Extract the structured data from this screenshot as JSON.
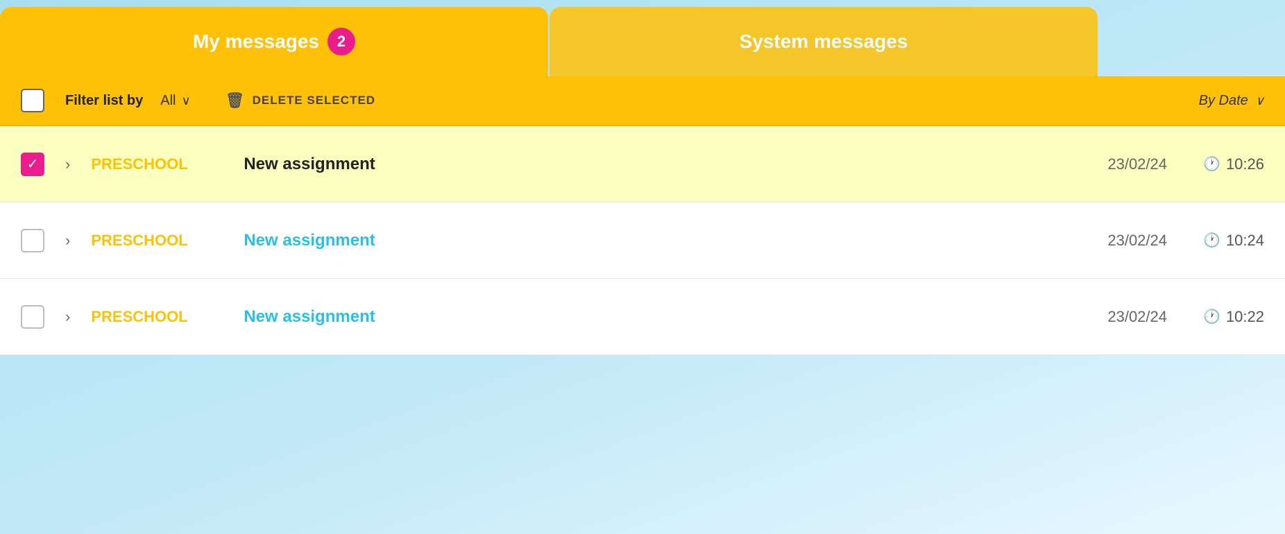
{
  "tabs": {
    "my_messages": {
      "label": "My messages",
      "badge": "2"
    },
    "system_messages": {
      "label": "System messages"
    }
  },
  "toolbar": {
    "filter_label": "Filter list by",
    "filter_value": "All",
    "delete_label": "DELETE SELECTED",
    "sort_label": "By Date"
  },
  "messages": [
    {
      "id": 1,
      "checked": true,
      "read": true,
      "category": "PRESCHOOL",
      "title": "New assignment",
      "title_style": "read",
      "date": "23/02/24",
      "time": "10:26"
    },
    {
      "id": 2,
      "checked": false,
      "read": false,
      "category": "PRESCHOOL",
      "title": "New assignment",
      "title_style": "unread",
      "date": "23/02/24",
      "time": "10:24"
    },
    {
      "id": 3,
      "checked": false,
      "read": false,
      "category": "PRESCHOOL",
      "title": "New assignment",
      "title_style": "unread",
      "date": "23/02/24",
      "time": "10:22"
    }
  ],
  "icons": {
    "checkmark": "✓",
    "chevron_down": "∨",
    "chevron_right": ">",
    "trash": "🗑",
    "clock": "🕐"
  }
}
